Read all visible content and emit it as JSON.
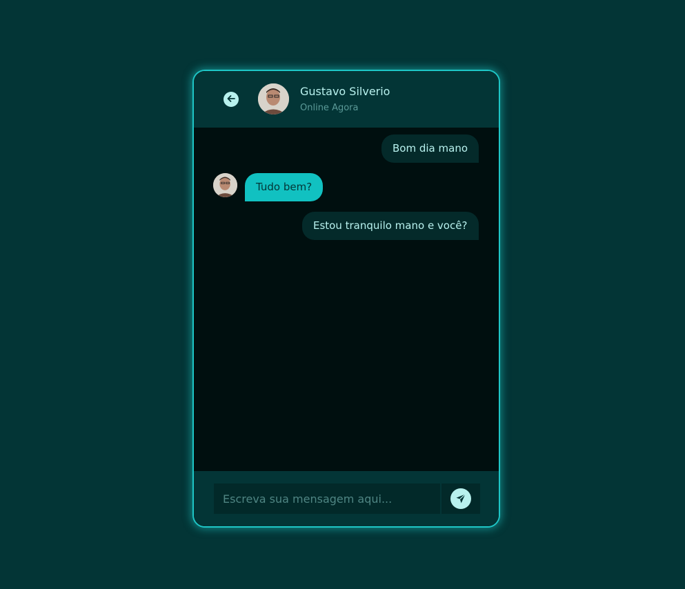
{
  "header": {
    "back_icon": "arrow-left-circle-icon",
    "contact_name": "Gustavo Silverio",
    "contact_status": "Online Agora"
  },
  "messages": [
    {
      "direction": "sent",
      "text": "Bom dia mano"
    },
    {
      "direction": "received",
      "text": "Tudo bem?"
    },
    {
      "direction": "sent",
      "text": "Estou tranquilo mano e você?"
    }
  ],
  "composer": {
    "placeholder": "Escreva sua mensagem aqui...",
    "value": "",
    "send_icon": "paper-plane-icon"
  },
  "colors": {
    "page_background": "#033536",
    "accent": "#1ec6c6",
    "received_bubble": "#11c1c1",
    "sent_bubble": "#042a2a",
    "chat_background": "#000f0f",
    "text_light": "#b8f1ee"
  }
}
